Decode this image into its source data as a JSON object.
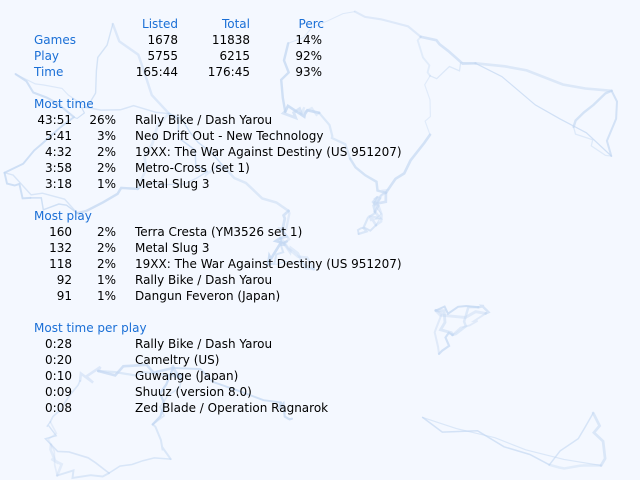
{
  "summary": {
    "headers": {
      "listed": "Listed",
      "total": "Total",
      "perc": "Perc"
    },
    "rows": [
      {
        "label": "Games",
        "listed": "1678",
        "total": "11838",
        "perc": "14%"
      },
      {
        "label": "Play",
        "listed": "5755",
        "total": "6215",
        "perc": "92%"
      },
      {
        "label": "Time",
        "listed": "165:44",
        "total": "176:45",
        "perc": "93%"
      }
    ]
  },
  "most_time": {
    "title": "Most time",
    "rows": [
      {
        "value": "43:51",
        "perc": "26%",
        "game": "Rally Bike / Dash Yarou"
      },
      {
        "value": "5:41",
        "perc": "3%",
        "game": "Neo Drift Out - New Technology"
      },
      {
        "value": "4:32",
        "perc": "2%",
        "game": "19XX: The War Against Destiny (US 951207)"
      },
      {
        "value": "3:58",
        "perc": "2%",
        "game": "Metro-Cross (set 1)"
      },
      {
        "value": "3:18",
        "perc": "1%",
        "game": "Metal Slug 3"
      }
    ]
  },
  "most_play": {
    "title": "Most play",
    "rows": [
      {
        "value": "160",
        "perc": "2%",
        "game": "Terra Cresta (YM3526 set 1)"
      },
      {
        "value": "132",
        "perc": "2%",
        "game": "Metal Slug 3"
      },
      {
        "value": "118",
        "perc": "2%",
        "game": "19XX: The War Against Destiny (US 951207)"
      },
      {
        "value": "92",
        "perc": "1%",
        "game": "Rally Bike / Dash Yarou"
      },
      {
        "value": "91",
        "perc": "1%",
        "game": "Dangun Feveron (Japan)"
      }
    ]
  },
  "most_time_per_play": {
    "title": "Most time per play",
    "rows": [
      {
        "value": "0:28",
        "game": "Rally Bike / Dash Yarou"
      },
      {
        "value": "0:20",
        "game": "Cameltry (US)"
      },
      {
        "value": "0:10",
        "game": "Guwange (Japan)"
      },
      {
        "value": "0:09",
        "game": "Shuuz (version 8.0)"
      },
      {
        "value": "0:08",
        "game": "Zed Blade / Operation Ragnarok"
      }
    ]
  },
  "colors": {
    "heading": "#1a6fd6",
    "text": "#000000",
    "background": "#f4f8ff",
    "crackle": "#c4d8f2"
  }
}
